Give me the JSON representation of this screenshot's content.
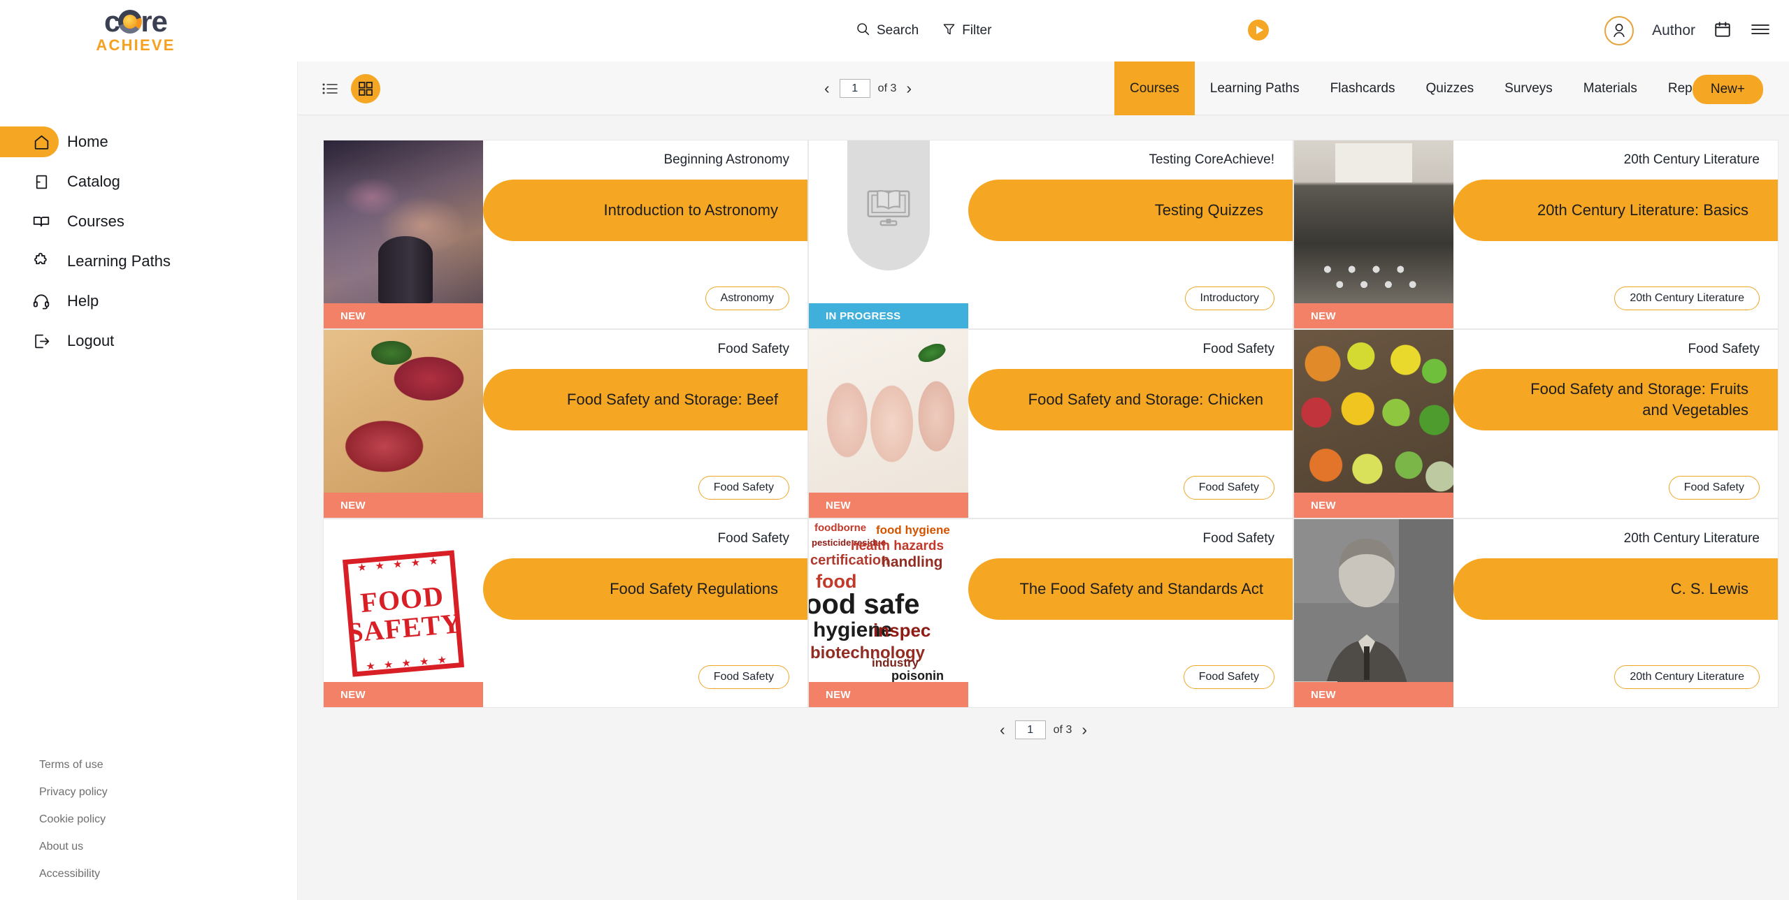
{
  "brand": {
    "logo_core": "core",
    "logo_achieve": "ACHIEVE"
  },
  "header": {
    "search_label": "Search",
    "filter_label": "Filter",
    "author_label": "Author",
    "icons": [
      "search-icon",
      "filter-icon",
      "play-icon",
      "avatar-icon",
      "calendar-icon",
      "hamburger-icon"
    ]
  },
  "sidebar": {
    "items": [
      {
        "label": "Home",
        "icon": "home-icon",
        "active": true
      },
      {
        "label": "Catalog",
        "icon": "catalog-book-icon",
        "active": false
      },
      {
        "label": "Courses",
        "icon": "open-book-icon",
        "active": false
      },
      {
        "label": "Learning Paths",
        "icon": "puzzle-piece-icon",
        "active": false
      },
      {
        "label": "Help",
        "icon": "headset-icon",
        "active": false
      },
      {
        "label": "Logout",
        "icon": "logout-icon",
        "active": false
      }
    ],
    "footer_links": [
      "Terms of use",
      "Privacy policy",
      "Cookie policy",
      "About us",
      "Accessibility"
    ]
  },
  "toolbar": {
    "view_list_icon": "list-view-icon",
    "view_grid_icon": "grid-view-icon",
    "active_view": "grid",
    "pagination": {
      "page": "1",
      "of_label": "of 3",
      "prev_icon": "chevron-left-icon",
      "next_icon": "chevron-right-icon"
    },
    "tabs": [
      {
        "label": "Courses",
        "active": true
      },
      {
        "label": "Learning Paths",
        "active": false
      },
      {
        "label": "Flashcards",
        "active": false
      },
      {
        "label": "Quizzes",
        "active": false
      },
      {
        "label": "Surveys",
        "active": false
      },
      {
        "label": "Materials",
        "active": false
      },
      {
        "label": "Reports",
        "active": false
      }
    ],
    "new_button": "New+"
  },
  "bottom_pagination": {
    "page": "1",
    "of_label": "of 3"
  },
  "colors": {
    "accent_orange": "#f5a623",
    "status_new": "#f28168",
    "status_in_progress": "#3fafdc",
    "panel_bg": "#f4f4f4"
  },
  "cards": [
    {
      "category": "Beginning Astronomy",
      "title": "Introduction to Astronomy",
      "tag": "Astronomy",
      "status": "NEW",
      "status_type": "new",
      "thumb": "thumb-astronomy"
    },
    {
      "category": "Testing CoreAchieve!",
      "title": "Testing Quizzes",
      "tag": "Introductory",
      "status": "IN PROGRESS",
      "status_type": "inprogress",
      "thumb": "thumb-placeholder"
    },
    {
      "category": "20th Century Literature",
      "title": "20th Century Literature: Basics",
      "tag": "20th Century Literature",
      "status": "NEW",
      "status_type": "new",
      "thumb": "thumb-typewriter"
    },
    {
      "category": "Food Safety",
      "title": "Food Safety and Storage: Beef",
      "tag": "Food Safety",
      "status": "NEW",
      "status_type": "new",
      "thumb": "thumb-beef"
    },
    {
      "category": "Food Safety",
      "title": "Food Safety and Storage: Chicken",
      "tag": "Food Safety",
      "status": "NEW",
      "status_type": "new",
      "thumb": "thumb-chicken"
    },
    {
      "category": "Food Safety",
      "title": "Food Safety and Storage: Fruits and Vegetables",
      "tag": "Food Safety",
      "status": "NEW",
      "status_type": "new",
      "thumb": "thumb-produce"
    },
    {
      "category": "Food Safety",
      "title": "Food Safety Regulations",
      "tag": "Food Safety",
      "status": "NEW",
      "status_type": "new",
      "thumb": "thumb-stamp"
    },
    {
      "category": "Food Safety",
      "title": "The Food Safety and Standards Act",
      "tag": "Food Safety",
      "status": "NEW",
      "status_type": "new",
      "thumb": "thumb-wordcloud"
    },
    {
      "category": "20th Century Literature",
      "title": "C. S. Lewis",
      "tag": "20th Century Literature",
      "status": "NEW",
      "status_type": "new",
      "thumb": "thumb-portrait"
    }
  ],
  "thumb_text": {
    "stamp_line1": "FOOD",
    "stamp_line2": "SAFETY",
    "wordcloud": [
      "foodborne",
      "food hygiene",
      "pesticide residue",
      "health hazards",
      "certification",
      "handling",
      "food",
      "ood safe",
      "hygiene",
      "inspec",
      "biotechnology",
      "industry",
      "poisonin"
    ]
  }
}
